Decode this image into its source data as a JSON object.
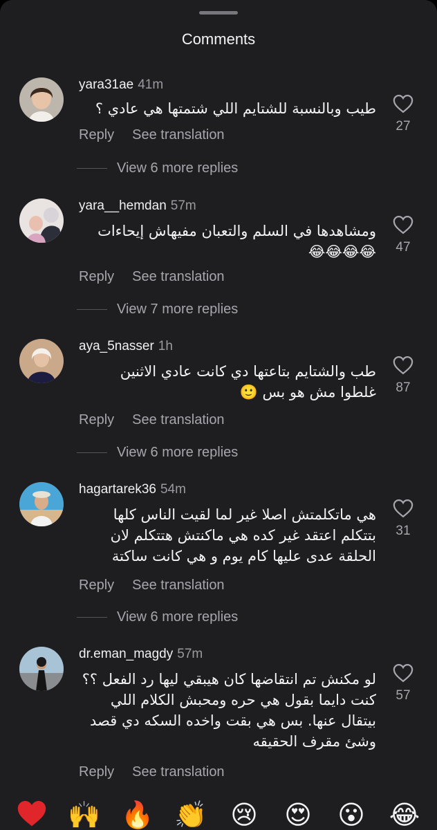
{
  "sheet": {
    "title": "Comments"
  },
  "comments": [
    {
      "username": "yara31ae",
      "time": "41m",
      "lines": [
        "طيب وبالنسبة للشتايم اللي شتمتها هي عادي ؟"
      ],
      "reply_label": "Reply",
      "translate_label": "See translation",
      "likes": "27",
      "more_replies": "View 6 more replies"
    },
    {
      "username": "yara__hemdan",
      "time": "57m",
      "lines": [
        "ومشاهدها في السلم والتعبان مفيهاش إيحاءات",
        "😂😂😂😂"
      ],
      "reply_label": "Reply",
      "translate_label": "See translation",
      "likes": "47",
      "more_replies": "View 7 more replies"
    },
    {
      "username": "aya_5nasser",
      "time": "1h",
      "lines": [
        "طب والشتايم بتاعتها دي كانت عادي الاثنين",
        "غلطوا مش هو بس 🙂"
      ],
      "reply_label": "Reply",
      "translate_label": "See translation",
      "likes": "87",
      "more_replies": "View 6 more replies"
    },
    {
      "username": "hagartarek36",
      "time": "54m",
      "lines": [
        "هي ماتكلمتش اصلا غير لما لقيت الناس كلها",
        "بتتكلم اعتقد غير كده هي ماكنتش هتتكلم لان",
        "الحلقة عدى عليها كام يوم و هي كانت ساكتة"
      ],
      "reply_label": "Reply",
      "translate_label": "See translation",
      "likes": "31",
      "more_replies": "View 6 more replies"
    },
    {
      "username": "dr.eman_magdy",
      "time": "57m",
      "lines": [
        "لو مكنش تم انتقاضها كان هيبقي ليها رد الفعل ؟؟",
        "كنت دايما بقول هي حره ومحبش الكلام اللي",
        "بيتقال عنها.  بس هي بقت واخده السكه دي قصد",
        "وشئ مقرف الحقيقه"
      ],
      "reply_label": "Reply",
      "translate_label": "See translation",
      "likes": "57"
    }
  ],
  "emoji_bar": [
    {
      "icon": "red-heart-icon",
      "glyph": "❤"
    },
    {
      "icon": "raising-hands-icon",
      "glyph": "🙌"
    },
    {
      "icon": "fire-icon",
      "glyph": "🔥"
    },
    {
      "icon": "clapping-hands-icon",
      "glyph": "👏"
    },
    {
      "icon": "crying-face-icon",
      "glyph": "😢"
    },
    {
      "icon": "heart-eyes-icon",
      "glyph": "😍"
    },
    {
      "icon": "surprised-face-icon",
      "glyph": "😮"
    },
    {
      "icon": "tears-of-joy-icon",
      "glyph": "😂"
    }
  ]
}
